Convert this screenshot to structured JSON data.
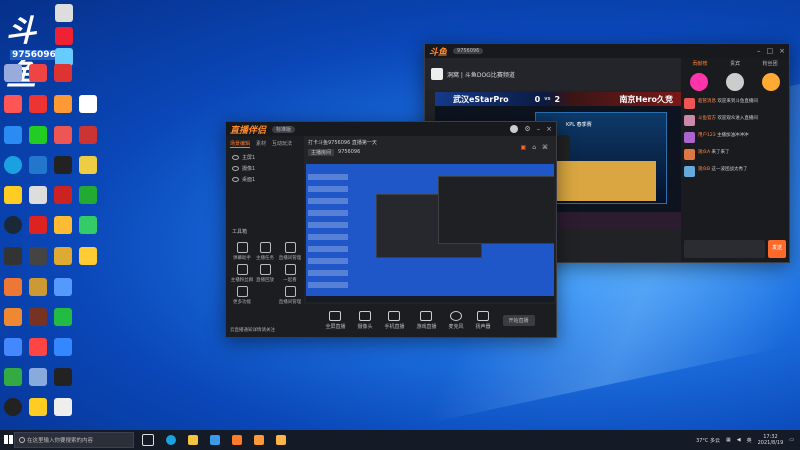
{
  "desktop": {
    "logo_text": "斗鱼",
    "room_number": "9756096"
  },
  "obs_window": {
    "title": "直播伴侣",
    "version_pill": "标准版",
    "side_tabs": [
      "场景编辑",
      "素材",
      "互动玩法"
    ],
    "scenes": [
      "主屏1",
      "摄像1",
      "桌面1"
    ],
    "tools_title": "工具箱",
    "tools": [
      "弹幕助手",
      "主播任务",
      "直播间管理",
      "主播粉丝群",
      "直播回放",
      "一起看",
      "更多功能",
      "直播间管理"
    ],
    "room_title": "打卡斗鱼9756096 直播第一天",
    "room_tag": "主播房间",
    "room_meta": "9756096",
    "bottom_tools": [
      "全屏直播",
      "摄像头",
      "手机直播",
      "游戏直播",
      "麦克风",
      "扬声器"
    ],
    "start_label": "开始直播",
    "notice": "云直播通知详情请关注"
  },
  "big_window": {
    "title": "斗鱼",
    "room": "9756096",
    "streamer_line": "洞窝 | 斗鱼DOG比赛频道",
    "team_left": "武汉eStarPro",
    "score_left": "0",
    "score_right": "2",
    "team_right": "南京Hero久竞",
    "match_label": "KPL 春季赛",
    "chat_tabs": [
      "贡献榜",
      "贵宾",
      "粉丝团"
    ],
    "chat": [
      {
        "name": "超管消息",
        "text": "欢迎来到斗鱼直播间"
      },
      {
        "name": "斗鱼官方",
        "text": "欢迎观众进入直播间"
      },
      {
        "name": "用户123",
        "text": "主播加油冲冲冲"
      },
      {
        "name": "观众A",
        "text": "来了来了"
      },
      {
        "name": "观众B",
        "text": "这一波团战太秀了"
      }
    ],
    "send_label": "发送"
  },
  "taskbar": {
    "search_placeholder": "在这里输入你要搜索的内容",
    "weather": "37°C 多云",
    "lang": "英",
    "time": "17:32",
    "date": "2021/8/19"
  }
}
